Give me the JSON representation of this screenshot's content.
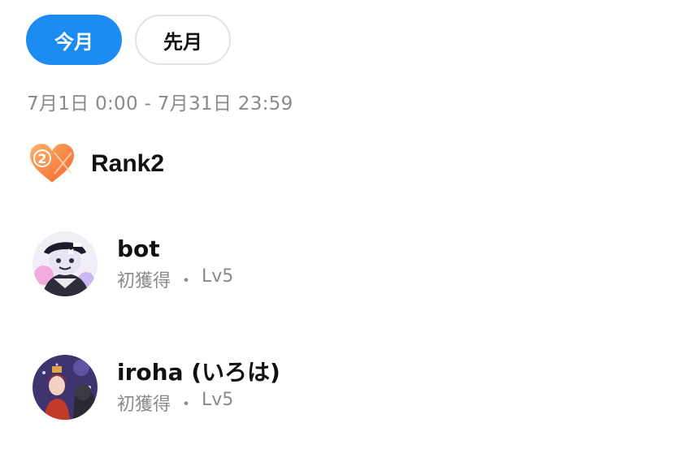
{
  "tabs": {
    "this_month": "今月",
    "last_month": "先月"
  },
  "period": {
    "text": "7月1日 0:00 - 7月31日 23:59"
  },
  "rank": {
    "badge_number": "2",
    "title": "Rank2"
  },
  "users": [
    {
      "name": "bot",
      "status": "初獲得",
      "separator": "・",
      "level": "Lv5"
    },
    {
      "name": "iroha (いろは)",
      "status": "初獲得",
      "separator": "・",
      "level": "Lv5"
    }
  ],
  "colors": {
    "accent": "#1d8cf2",
    "badge": "#f58a3a",
    "muted_text": "#8a8a8a"
  }
}
